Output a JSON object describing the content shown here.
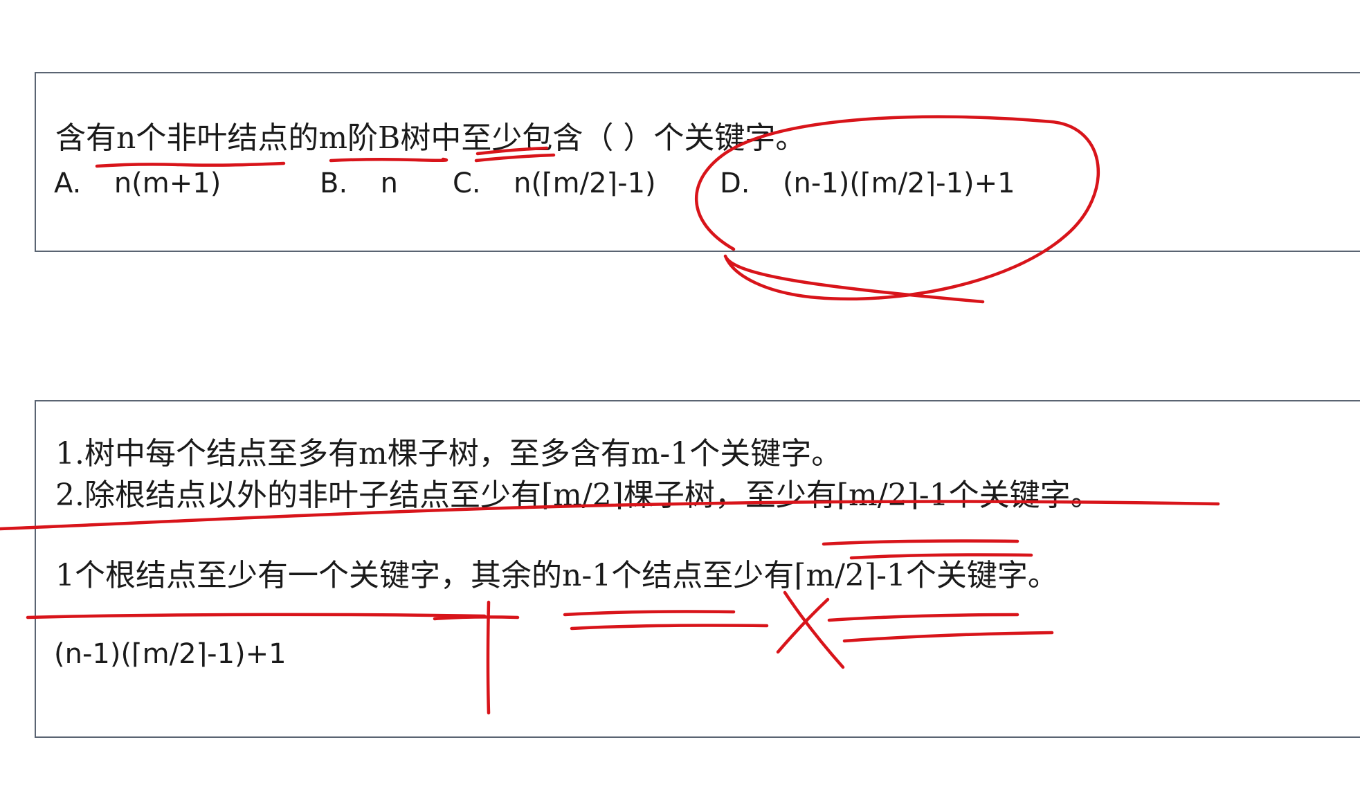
{
  "watermark": "",
  "question": {
    "stem": "含有n个非叶结点的m阶B树中至少包含（        ）个关键字。",
    "options": [
      {
        "key": "A.",
        "text": "n(m+1)"
      },
      {
        "key": "B.",
        "text": "n"
      },
      {
        "key": "C.",
        "text": "n(⌈m/2⌉-1)"
      },
      {
        "key": "D.",
        "text": "(n-1)(⌈m/2⌉-1)+1"
      }
    ]
  },
  "notes": {
    "rule1": "1.树中每个结点至多有m棵子树，至多含有m-1个关键字。",
    "rule2": "2.除根结点以外的非叶子结点至少有⌈m/2⌉棵子树，至少有⌈m/2⌉-1个关键字。",
    "explanation": "1个根结点至少有一个关键字，其余的n-1个结点至少有⌈m/2⌉-1个关键字。",
    "formula": "(n-1)(⌈m/2⌉-1)+1"
  },
  "annotation": {
    "ink_color": "#d8141a"
  }
}
